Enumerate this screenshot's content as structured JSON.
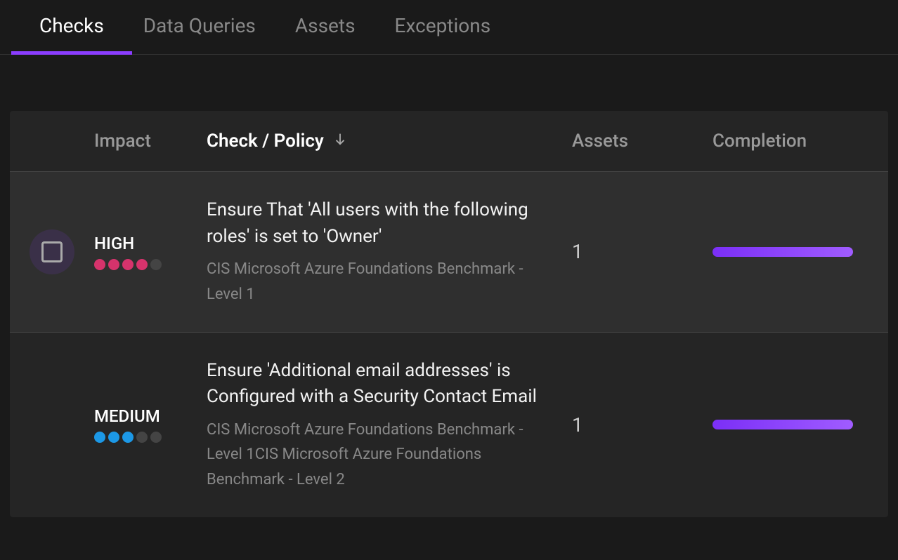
{
  "tabs": [
    {
      "label": "Checks",
      "active": true
    },
    {
      "label": "Data Queries",
      "active": false
    },
    {
      "label": "Assets",
      "active": false
    },
    {
      "label": "Exceptions",
      "active": false
    }
  ],
  "columns": {
    "impact": "Impact",
    "check": "Check / Policy",
    "assets": "Assets",
    "completion": "Completion"
  },
  "rows": [
    {
      "impact_label": "HIGH",
      "impact_level": "high",
      "impact_filled": 4,
      "title": "Ensure That 'All users with the following roles' is set to 'Owner'",
      "subtitle": "CIS Microsoft Azure Foundations Benchmark - Level 1",
      "assets": "1",
      "completion": 100,
      "hovered": true
    },
    {
      "impact_label": "MEDIUM",
      "impact_level": "medium",
      "impact_filled": 3,
      "title": "Ensure 'Additional email addresses' is Configured with a Security Contact Email",
      "subtitle": "CIS Microsoft Azure Foundations Benchmark - Level 1CIS Microsoft Azure Foundations Benchmark - Level 2",
      "assets": "1",
      "completion": 100,
      "hovered": false
    }
  ]
}
